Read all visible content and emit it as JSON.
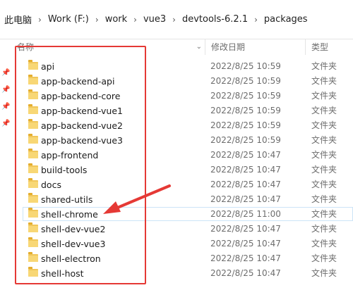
{
  "breadcrumb": [
    "此电脑",
    "Work (F:)",
    "work",
    "vue3",
    "devtools-6.2.1",
    "packages"
  ],
  "breadcrumb_separator": "›",
  "columns": {
    "name": "名称",
    "date": "修改日期",
    "type": "类型",
    "sort_icon": "chevron-down-icon"
  },
  "rows": [
    {
      "name": "api",
      "date": "2022/8/25 10:59",
      "type": "文件夹"
    },
    {
      "name": "app-backend-api",
      "date": "2022/8/25 10:59",
      "type": "文件夹"
    },
    {
      "name": "app-backend-core",
      "date": "2022/8/25 10:59",
      "type": "文件夹"
    },
    {
      "name": "app-backend-vue1",
      "date": "2022/8/25 10:59",
      "type": "文件夹"
    },
    {
      "name": "app-backend-vue2",
      "date": "2022/8/25 10:59",
      "type": "文件夹"
    },
    {
      "name": "app-backend-vue3",
      "date": "2022/8/25 10:59",
      "type": "文件夹"
    },
    {
      "name": "app-frontend",
      "date": "2022/8/25 10:47",
      "type": "文件夹"
    },
    {
      "name": "build-tools",
      "date": "2022/8/25 10:47",
      "type": "文件夹"
    },
    {
      "name": "docs",
      "date": "2022/8/25 10:47",
      "type": "文件夹"
    },
    {
      "name": "shared-utils",
      "date": "2022/8/25 10:47",
      "type": "文件夹"
    },
    {
      "name": "shell-chrome",
      "date": "2022/8/25 11:00",
      "type": "文件夹",
      "selected": true
    },
    {
      "name": "shell-dev-vue2",
      "date": "2022/8/25 10:47",
      "type": "文件夹"
    },
    {
      "name": "shell-dev-vue3",
      "date": "2022/8/25 10:47",
      "type": "文件夹"
    },
    {
      "name": "shell-electron",
      "date": "2022/8/25 10:47",
      "type": "文件夹"
    },
    {
      "name": "shell-host",
      "date": "2022/8/25 10:47",
      "type": "文件夹"
    }
  ],
  "annotation": {
    "color": "#e53935"
  },
  "colors": {
    "folder": "#f8d775",
    "selection_border": "#cce4f7"
  }
}
